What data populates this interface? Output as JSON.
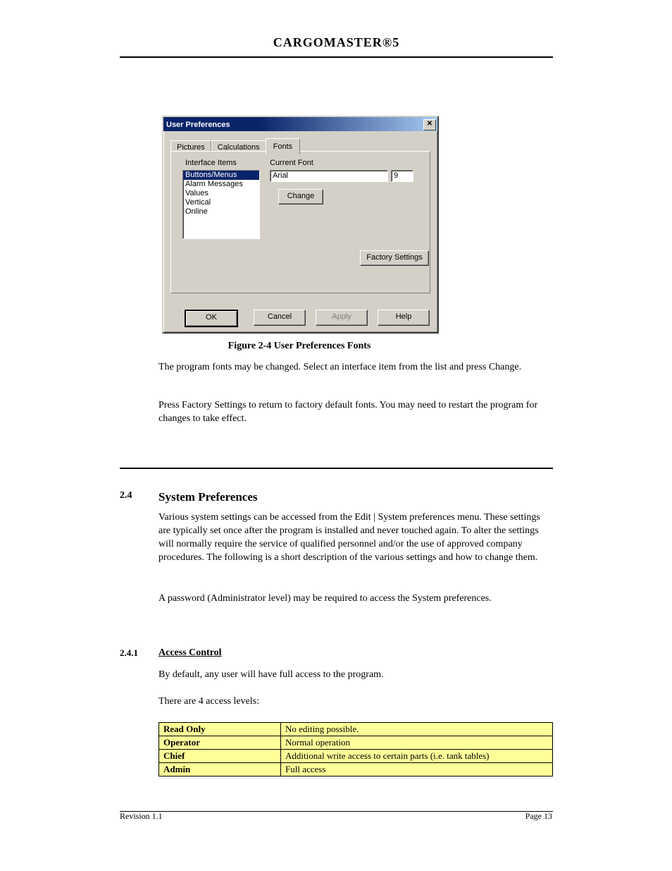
{
  "header": {
    "title": "CARGOMASTER®5"
  },
  "dialog": {
    "title": "User Preferences",
    "close_glyph": "✕",
    "tabs": {
      "pictures": "Pictures",
      "calculations": "Calculations",
      "fonts": "Fonts"
    },
    "labels": {
      "interface_items": "Interface Items",
      "current_font": "Current Font"
    },
    "listbox_items": [
      "Buttons/Menus",
      "Alarm Messages",
      "Values",
      "Vertical",
      "Online"
    ],
    "font_name": "Arial",
    "font_size": "9",
    "buttons": {
      "change": "Change",
      "factory": "Factory Settings",
      "ok": "OK",
      "cancel": "Cancel",
      "apply": "Apply",
      "help": "Help"
    }
  },
  "figure_caption": "Figure 2-4 User Preferences Fonts",
  "para1": "The program fonts may be changed. Select an interface item from the list and press Change.",
  "para2": "Press Factory Settings to return to factory default fonts. You may need to restart the program for changes to take effect.",
  "chapter": {
    "num": "2.4",
    "title": "System Preferences"
  },
  "para3": "Various system settings can be accessed from the Edit | System preferences menu. These settings are typically set once after the program is installed and never touched again. To alter the settings will normally require the service of qualified personnel and/or the use of approved company procedures. The following is a short description of the various settings and how to change them.",
  "para4": "A password (Administrator level) may be required to access the System preferences.",
  "section": {
    "num": "2.4.1",
    "title": "Access Control"
  },
  "para5": "By default, any user will have full access to the program.",
  "para6": "There are 4 access levels:",
  "rights_table": {
    "rows": [
      {
        "c1": "Read Only",
        "c2": "No editing possible."
      },
      {
        "c1": "Operator",
        "c2": "Normal operation"
      },
      {
        "c1": "Chief",
        "c2": "Additional write access to certain parts (i.e. tank tables)"
      },
      {
        "c1": "Admin",
        "c2": "Full access"
      }
    ]
  },
  "footer": {
    "left": "Revision 1.1",
    "right": "Page 13"
  }
}
